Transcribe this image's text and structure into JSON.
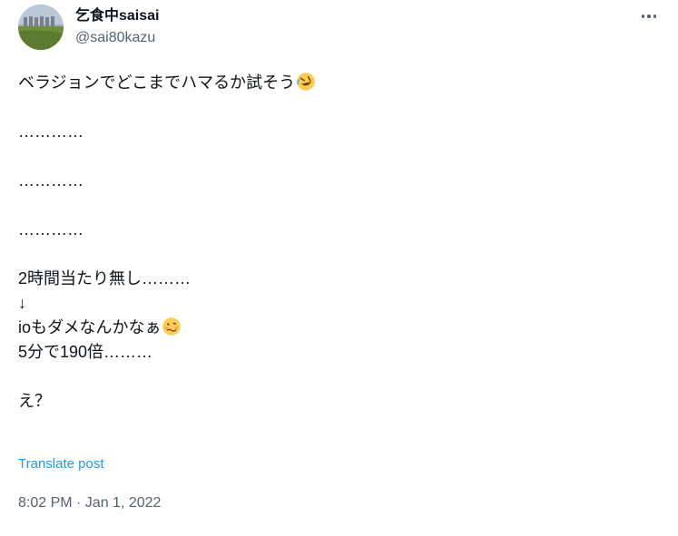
{
  "author": {
    "display_name": "乞食中saisai",
    "handle": "@sai80kazu"
  },
  "icons": {
    "avatar": "landscape-avatar",
    "more": "more-options-icon",
    "emoji_1": "rolling-on-floor-laughing-emoji",
    "emoji_2": "woozy-face-emoji"
  },
  "post": {
    "lines": [
      "ベラジョンでどこまでハマるか試そう",
      "",
      "…………",
      "",
      "…………",
      "",
      "…………",
      "",
      "2時間当たり無し………",
      "↓",
      "ioもダメなんかなぁ",
      "5分で190倍………",
      "",
      "え？"
    ]
  },
  "translate_label": "Translate post",
  "timestamp": "8:02 PM · Jan 1, 2022",
  "colors": {
    "text": "#0f1419",
    "secondary": "#536471",
    "link": "#1d9bf0"
  }
}
